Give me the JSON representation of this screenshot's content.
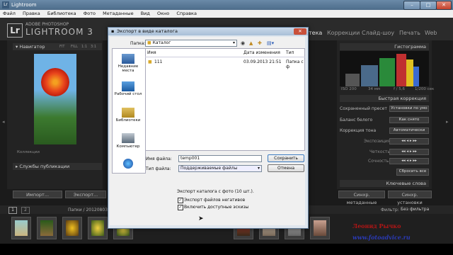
{
  "window": {
    "title": "Lightroom",
    "app_icon": "Lr"
  },
  "menu": [
    "Файл",
    "Правка",
    "Библиотека",
    "Фото",
    "Метаданные",
    "Вид",
    "Окно",
    "Справка"
  ],
  "lr": {
    "logo": "Lr",
    "subtitle": "ADOBE PHOTOSHOP",
    "name": "LIGHTROOM 3",
    "modules": [
      "Библиотека",
      "Коррекции",
      "Слайд-шоу",
      "Печать",
      "Web"
    ],
    "modules_visible": [
      "тека",
      "Коррекции",
      "Слайд-шоу",
      "Печать",
      "Web"
    ]
  },
  "left": {
    "navigator": "Навигатор",
    "nav_modes": [
      "FIT",
      "FILL",
      "1:1",
      "3:1"
    ],
    "collections": "Коллекции",
    "publish": "Службы публикации",
    "import_button": "Импорт...",
    "export_button": "Экспорт..."
  },
  "right": {
    "histogram": "Гистограмма",
    "exif": [
      "ISO 200",
      "34 мм",
      "f / 5,6",
      "1/200 сек"
    ],
    "quick_develop": "Быстрая коррекция",
    "saved_preset_label": "Сохраненный пресет",
    "saved_preset_value": "Установки по умо",
    "white_balance_label": "Баланс белого",
    "white_balance_value": "Как снято",
    "tone_label": "Коррекция тона",
    "tone_auto": "Автоматически",
    "exposure": "Экспозиция",
    "clarity": "Четкость",
    "vibrance": "Сочность",
    "reset_all": "Сбросить все",
    "keywords": "Ключевые слова",
    "sync_meta": "Синхр. метаданные",
    "sync_settings": "Синхр. установки"
  },
  "filmstrip": {
    "pages": [
      "1",
      "2"
    ],
    "path": "Папки / 20120803 Ти",
    "filter_label": "Фильтр:",
    "filter_value": "Без фильтра"
  },
  "dialog": {
    "title": "Экспорт в виде каталога",
    "folder_label": "Папка:",
    "folder_value": "Каталог",
    "places": [
      "Недавние места",
      "Рабочий стол",
      "Библиотеки",
      "Компьютер",
      "Сеть"
    ],
    "columns": [
      "Имя",
      "Дата изменения",
      "Тип"
    ],
    "files": [
      {
        "name": "111",
        "date": "03.09.2013 21:51",
        "type": "Папка с ф"
      }
    ],
    "filename_label": "Имя файла:",
    "filename_value": "temp001",
    "filetype_label": "Тип файла:",
    "filetype_value": "Поддерживаемые файлы",
    "save_button": "Сохранить",
    "cancel_button": "Отмена",
    "export_info": "Экспорт каталога с фото (10 шт.).",
    "option1": "Экспорт файлов негативов",
    "option2": "Включить доступные эскизы",
    "option1_checked": true,
    "option2_checked": true
  },
  "watermark": {
    "name": "Леонид Рычко",
    "site": "www.fotoadvice.ru"
  },
  "colors": {
    "lr_bg": "#2b2b2b",
    "dialog_bg": "#f0f0f0",
    "watermark_red": "#b01515",
    "watermark_blue": "#2a3ab5"
  }
}
